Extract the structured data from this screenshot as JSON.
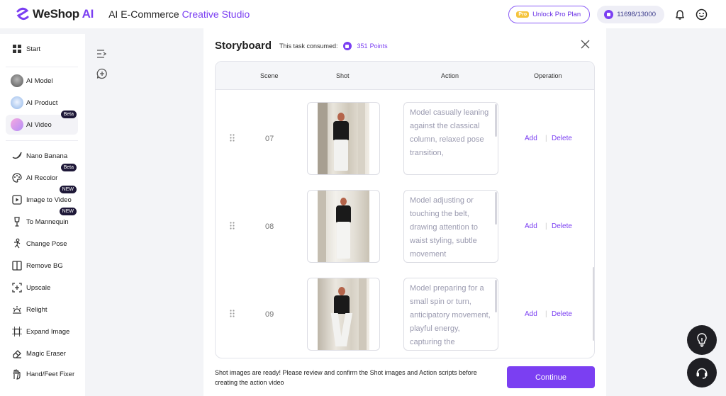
{
  "header": {
    "logo_we": "We",
    "logo_shop": "Shop",
    "logo_ai": " AI",
    "title_main": "AI E-Commerce",
    "title_accent": "Creative Studio",
    "pro_tag": "Pro",
    "unlock_label": "Unlock Pro Plan",
    "points": "11698/13000"
  },
  "sidebar": {
    "items": [
      {
        "label": "Start",
        "icon": "grid-icon"
      },
      {
        "label": "AI Model",
        "icon": "model-thumb"
      },
      {
        "label": "AI Product",
        "icon": "product-thumb"
      },
      {
        "label": "AI Video",
        "icon": "video-thumb",
        "badge": "Beta"
      },
      {
        "label": "Nano Banana",
        "icon": "banana-icon"
      },
      {
        "label": "AI Recolor",
        "icon": "palette-icon",
        "badge": "Beta"
      },
      {
        "label": "Image to Video",
        "icon": "image-video-icon",
        "badge": "NEW"
      },
      {
        "label": "To Mannequin",
        "icon": "mannequin-icon",
        "badge": "NEW"
      },
      {
        "label": "Change Pose",
        "icon": "pose-icon"
      },
      {
        "label": "Remove BG",
        "icon": "remove-bg-icon"
      },
      {
        "label": "Upscale",
        "icon": "upscale-icon"
      },
      {
        "label": "Relight",
        "icon": "relight-icon"
      },
      {
        "label": "Expand Image",
        "icon": "expand-icon"
      },
      {
        "label": "Magic Eraser",
        "icon": "eraser-icon"
      },
      {
        "label": "Hand/Feet Fixer",
        "icon": "hand-icon"
      }
    ]
  },
  "storyboard": {
    "title": "Storyboard",
    "consumed_label": "This task consumed:",
    "consumed_value": "351",
    "consumed_unit": "Points",
    "columns": [
      "Scene",
      "Shot",
      "Action",
      "Operation"
    ],
    "rows": [
      {
        "scene": "07",
        "action": "Model casually leaning against the classical column, relaxed pose transition,",
        "add": "Add",
        "delete": "Delete"
      },
      {
        "scene": "08",
        "action": "Model adjusting or touching the belt, drawing attention to waist styling, subtle movement",
        "add": "Add",
        "delete": "Delete"
      },
      {
        "scene": "09",
        "action": "Model preparing for a small spin or turn, anticipatory movement, playful energy, capturing the",
        "add": "Add",
        "delete": "Delete"
      }
    ],
    "separator": "|",
    "footer_note": "Shot images are ready! Please review and confirm the Shot images and Action scripts before creating the action video",
    "continue_label": "Continue"
  },
  "colors": {
    "accent": "#7b3ff2",
    "fab": "#1f1f24"
  }
}
